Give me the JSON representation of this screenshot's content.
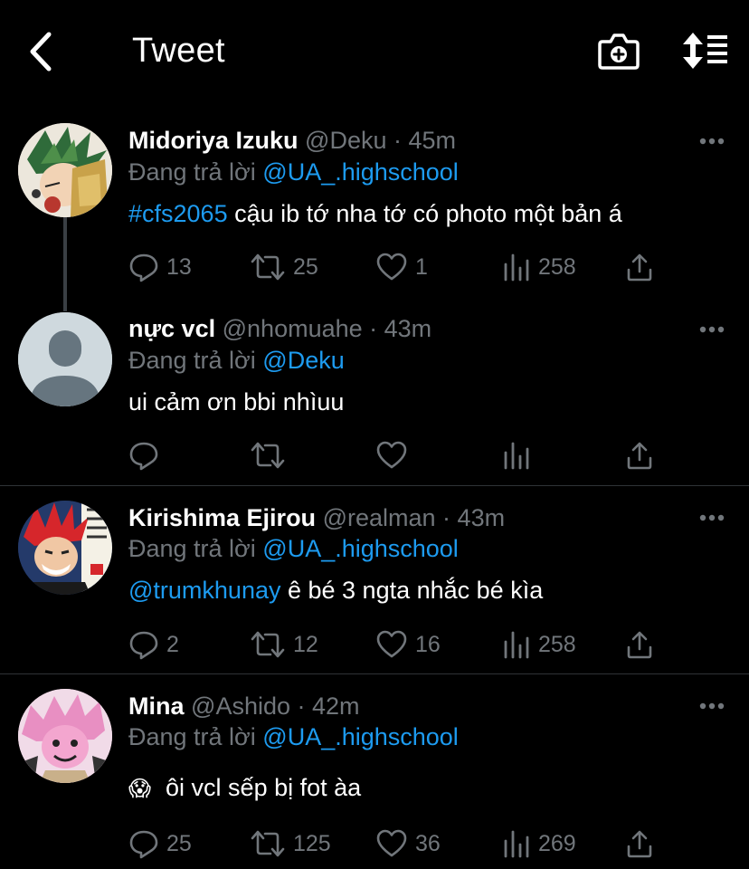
{
  "header": {
    "title": "Tweet"
  },
  "colors": {
    "background": "#000000",
    "link": "#1d9bf0",
    "muted": "#71767b",
    "text": "#ffffff"
  },
  "tweets": [
    {
      "name": "Midoriya Izuku",
      "handle": "@Deku",
      "time": "45m",
      "reply_prefix": "Đang trả lời",
      "reply_to": "@UA_.highschool",
      "text_link": "#cfs2065",
      "text": " cậu ib tớ nha tớ có photo một bản á",
      "stats": {
        "replies": "13",
        "retweets": "25",
        "likes": "1",
        "views": "258"
      }
    },
    {
      "name": "nực vcl",
      "handle": "@nhomuahe",
      "time": "43m",
      "reply_prefix": "Đang trả lời",
      "reply_to": "@Deku",
      "text": "ui cảm ơn bbi nhìuu",
      "stats": {
        "replies": "",
        "retweets": "",
        "likes": "",
        "views": ""
      }
    },
    {
      "name": "Kirishima Ejirou",
      "handle": "@realman",
      "time": "43m",
      "reply_prefix": "Đang trả lời",
      "reply_to": "@UA_.highschool",
      "text_link": "@trumkhunay",
      "text": " ê bé 3 ngta nhắc bé kìa",
      "stats": {
        "replies": "2",
        "retweets": "12",
        "likes": "16",
        "views": "258"
      }
    },
    {
      "name": "Mina",
      "handle": "@Ashido",
      "time": "42m",
      "reply_prefix": "Đang trả lời",
      "reply_to": "@UA_.highschool",
      "emoji": "😱",
      "text": "ôi vcl sếp bị fot àa",
      "stats": {
        "replies": "25",
        "retweets": "125",
        "likes": "36",
        "views": "269"
      }
    }
  ]
}
